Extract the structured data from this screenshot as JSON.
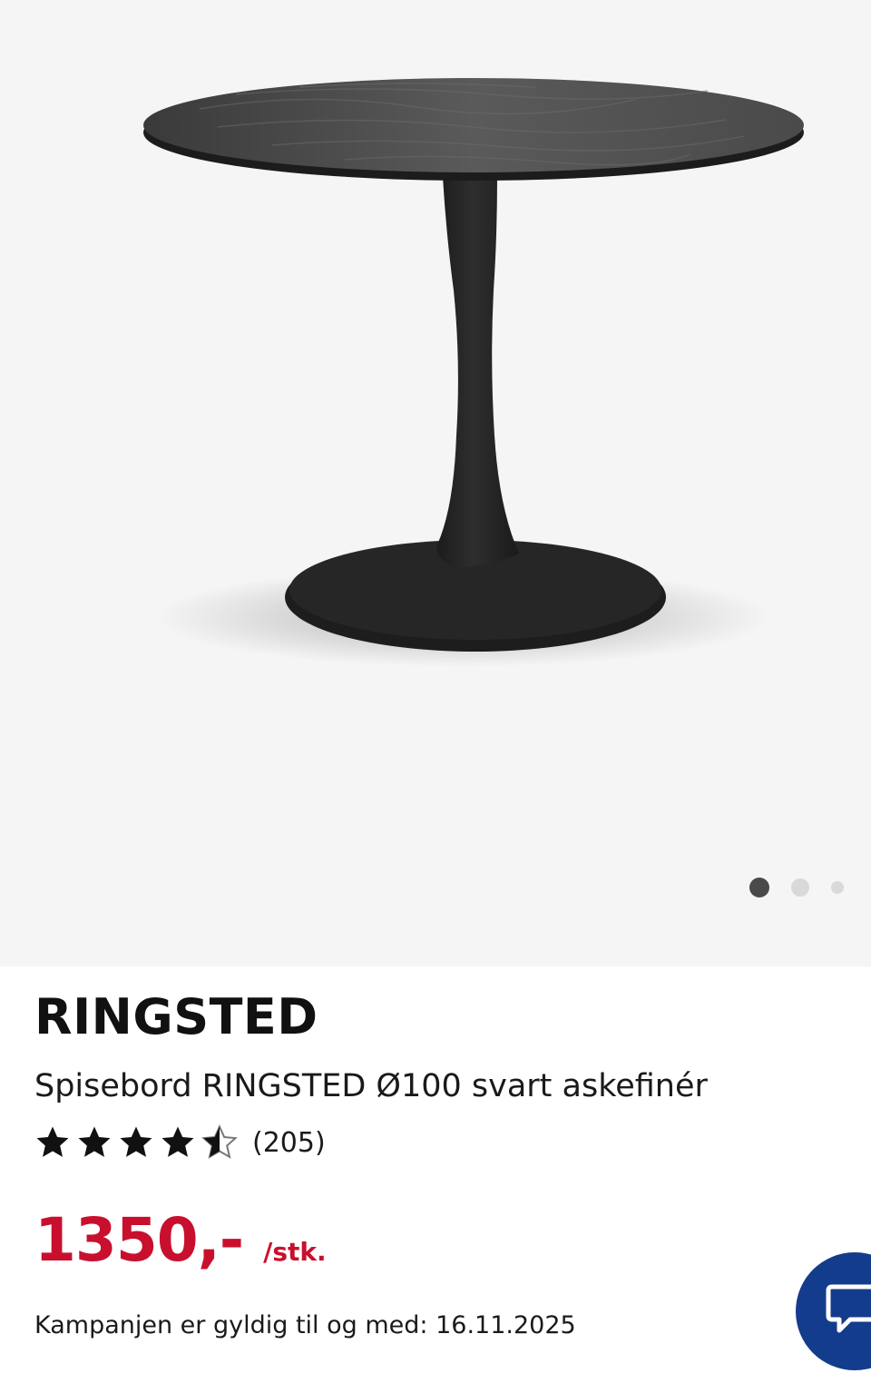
{
  "gallery": {
    "image_alt": "Spisebord RINGSTED Ø100 svart askefinér",
    "slide_count": 3,
    "active_slide": 1
  },
  "product": {
    "brand": "RINGSTED",
    "title": "Spisebord RINGSTED Ø100 svart askefinér",
    "rating_value": 4.6,
    "rating_max": 5,
    "review_count": "(205)",
    "price": "1350,-",
    "unit": "/stk.",
    "campaign": "Kampanjen er gyldig til og med: 16.11.2025"
  },
  "chat": {
    "icon": "chat-bubble-icon"
  },
  "colors": {
    "price_red": "#c8102e",
    "chat_blue": "#143c8c",
    "hero_bg": "#f5f5f5"
  }
}
